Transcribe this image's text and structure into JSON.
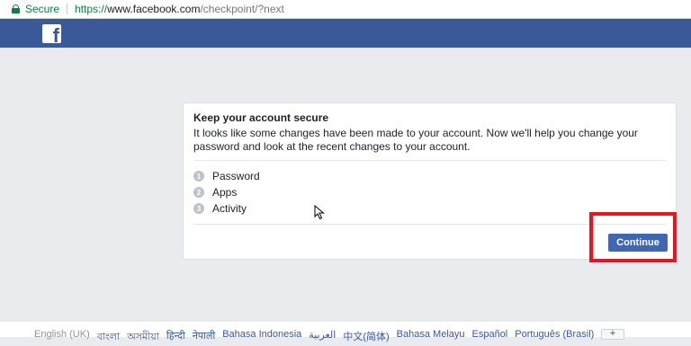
{
  "browser": {
    "secure_label": "Secure",
    "url_scheme": "https://",
    "url_host": "www.facebook.com",
    "url_path": "/checkpoint/?next"
  },
  "header": {
    "logo": "f"
  },
  "card": {
    "title": "Keep your account secure",
    "description": "It looks like some changes have been made to your account. Now we'll help you change your password and look at the recent changes to your account.",
    "steps": [
      {
        "number": "1",
        "label": "Password"
      },
      {
        "number": "2",
        "label": "Apps"
      },
      {
        "number": "3",
        "label": "Activity"
      }
    ],
    "continue_label": "Continue"
  },
  "footer": {
    "languages": [
      "English (UK)",
      "বাংলা",
      "অসমীয়া",
      "हिन्दी",
      "नेपाली",
      "Bahasa Indonesia",
      "العربية",
      "中文(简体)",
      "Bahasa Melayu",
      "Español",
      "Português (Brasil)"
    ],
    "more_label": "+"
  },
  "colors": {
    "facebook_blue": "#3b5998",
    "button_blue": "#4267b2",
    "highlight_red": "#e8141f",
    "secure_green": "#0b8043"
  }
}
